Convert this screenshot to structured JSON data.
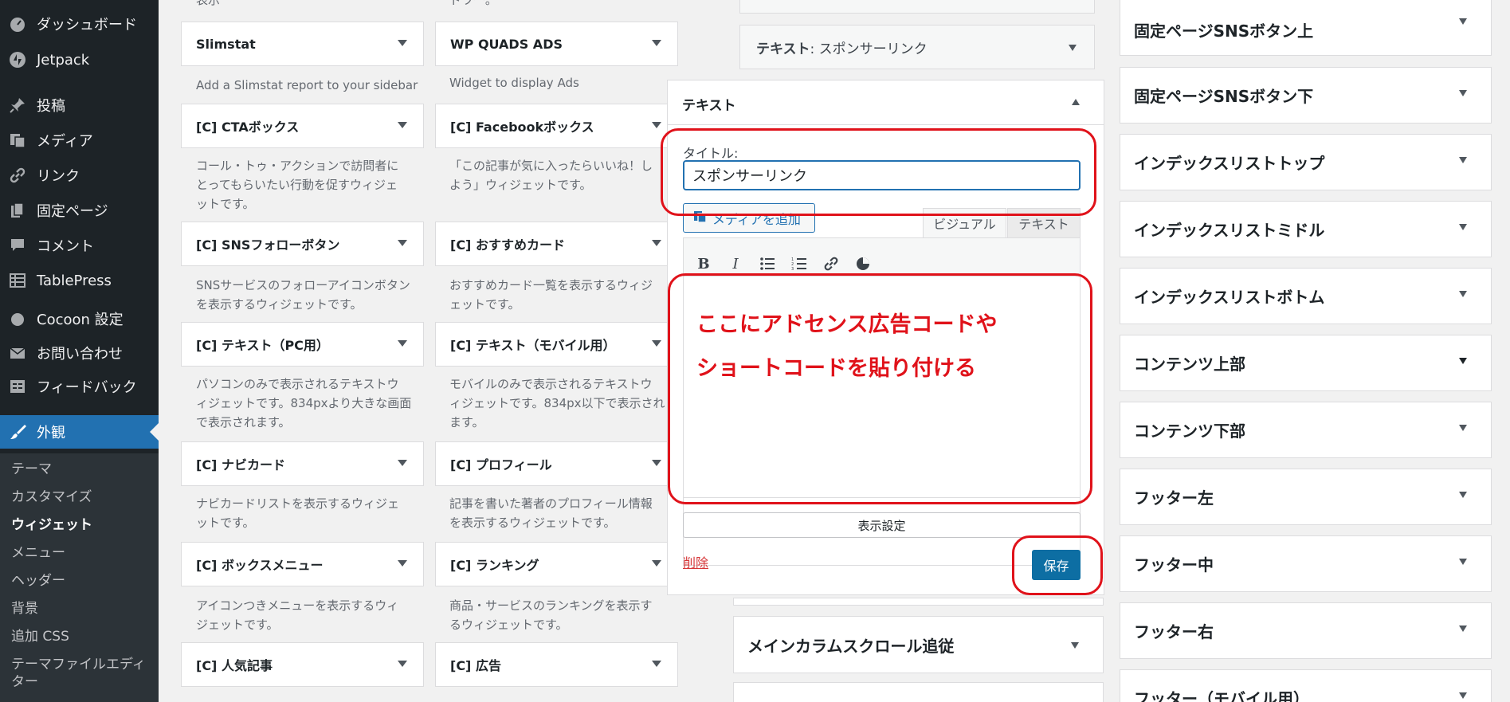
{
  "sidebar": {
    "items": [
      {
        "label": "ダッシュボード",
        "icon": "dashboard-icon"
      },
      {
        "label": "Jetpack",
        "icon": "jetpack-icon"
      },
      {
        "label": "投稿",
        "icon": "pin-icon"
      },
      {
        "label": "メディア",
        "icon": "media-icon"
      },
      {
        "label": "リンク",
        "icon": "link-icon"
      },
      {
        "label": "固定ページ",
        "icon": "page-icon"
      },
      {
        "label": "コメント",
        "icon": "comment-icon"
      },
      {
        "label": "TablePress",
        "icon": "table-icon"
      },
      {
        "label": "Cocoon 設定",
        "icon": "cocoon-icon"
      },
      {
        "label": "お問い合わせ",
        "icon": "mail-icon"
      },
      {
        "label": "フィードバック",
        "icon": "feedback-icon"
      },
      {
        "label": "外観",
        "icon": "brush-icon"
      }
    ],
    "submenu": [
      "テーマ",
      "カスタマイズ",
      "ウィジェット",
      "メニュー",
      "ヘッダー",
      "背景",
      "追加 CSS",
      "テーマファイルエディ",
      "ター"
    ]
  },
  "available": {
    "top_partial": [
      "表示",
      "ドワー。"
    ],
    "widgets": [
      {
        "title": "Slimstat",
        "desc": "Add a Slimstat report to your sidebar"
      },
      {
        "title": "WP QUADS ADS",
        "desc": "Widget to display Ads"
      },
      {
        "title": "[C] CTAボックス",
        "desc1": "コール・トゥ・アクションで訪問者に",
        "desc2": "とってもらいたい行動を促すウィジェ",
        "desc3": "ットです。"
      },
      {
        "title": "[C] Facebookボックス",
        "desc1": "「この記事が気に入ったらいいね！し",
        "desc2": "よう」ウィジェットです。"
      },
      {
        "title": "[C] SNSフォローボタン",
        "desc1": "SNSサービスのフォローアイコンボタン",
        "desc2": "を表示するウィジェットです。"
      },
      {
        "title": "[C] おすすめカード",
        "desc1": "おすすめカード一覧を表示するウィジ",
        "desc2": "ェットです。"
      },
      {
        "title": "[C] テキスト（PC用）",
        "desc1": "パソコンのみで表示されるテキストウ",
        "desc2": "ィジェットです。834pxより大きな画面",
        "desc3": "で表示されます。"
      },
      {
        "title": "[C] テキスト（モバイル用）",
        "desc1": "モバイルのみで表示されるテキストウ",
        "desc2": "ィジェットです。834px以下で表示され",
        "desc3": "ます。"
      },
      {
        "title": "[C] ナビカード",
        "desc1": "ナビカードリストを表示するウィジェ",
        "desc2": "ットです。"
      },
      {
        "title": "[C] プロフィール",
        "desc1": "記事を書いた著者のプロフィール情報",
        "desc2": "を表示するウィジェットです。"
      },
      {
        "title": "[C] ボックスメニュー",
        "desc1": "アイコンつきメニューを表示するウィ",
        "desc2": "ジェットです。"
      },
      {
        "title": "[C] ランキング",
        "desc1": "商品・サービスのランキングを表示す",
        "desc2": "るウィジェットです。"
      },
      {
        "title": "[C] 人気記事"
      },
      {
        "title": "[C] 広告"
      }
    ]
  },
  "middle": {
    "sponsored": "テキスト: スポンサーリンク",
    "sponsored_bold": "テキスト",
    "sponsored_rest": ": スポンサーリンク",
    "editor_title": "テキスト",
    "title_label": "タイトル:",
    "title_value": "スポンサーリンク",
    "add_media": "メディアを追加",
    "tab_visual": "ビジュアル",
    "tab_text": "テキスト",
    "annotation_line1": "ここにアドセンス広告コードや",
    "annotation_line2": "ショートコードを貼り付ける",
    "display_settings": "表示設定",
    "delete": "削除",
    "save": "保存",
    "main_scroll": "メインカラムスクロール追従"
  },
  "areas": [
    "固定ページSNSボタン上",
    "固定ページSNSボタン下",
    "インデックスリストトップ",
    "インデックスリストミドル",
    "インデックスリストボトム",
    "コンテンツ上部",
    "コンテンツ下部",
    "フッター左",
    "フッター中",
    "フッター右",
    "フッター（モバイル用）"
  ],
  "colors": {
    "annotation_red": "#e0121a",
    "wp_blue": "#2271b1",
    "save_blue": "#0d6ea3"
  }
}
